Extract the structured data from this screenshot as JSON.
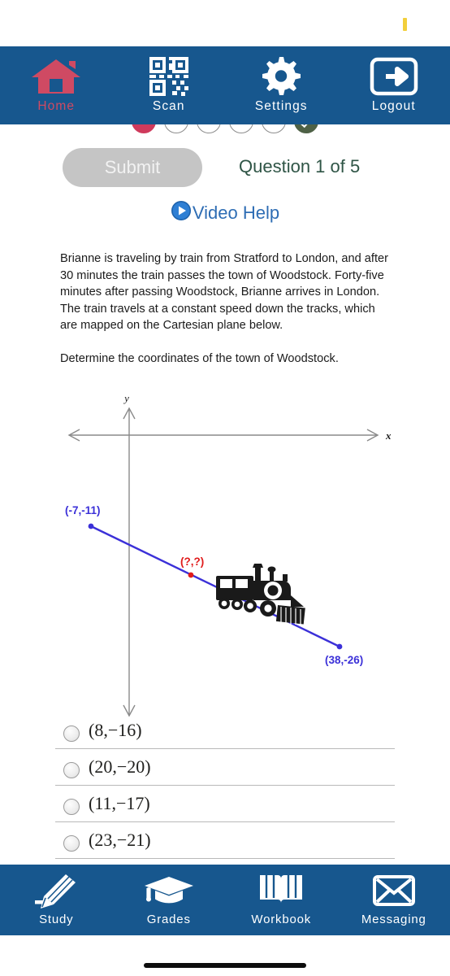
{
  "status_bar": {
    "indicator": "battery-mark"
  },
  "top_nav": {
    "items": [
      {
        "label": "Home",
        "icon": "home-icon"
      },
      {
        "label": "Scan",
        "icon": "qr-scan-icon"
      },
      {
        "label": "Settings",
        "icon": "gear-icon"
      },
      {
        "label": "Logout",
        "icon": "logout-arrow-icon"
      }
    ]
  },
  "progress": {
    "dots": [
      {
        "state": "current"
      },
      {
        "state": "empty"
      },
      {
        "state": "empty"
      },
      {
        "state": "empty"
      },
      {
        "state": "empty"
      },
      {
        "state": "done"
      }
    ]
  },
  "toolbar": {
    "submit_label": "Submit",
    "question_counter": "Question 1 of 5",
    "video_help_label": "Video Help"
  },
  "question": {
    "paragraph1": "Brianne is traveling by train from Stratford to London, and after 30 minutes the train passes the town of Woodstock. Forty-five minutes after passing Woodstock, Brianne arrives in London. The train travels at a constant speed down the tracks, which are mapped on the Cartesian plane below.",
    "paragraph2": "Determine the coordinates of the town of Woodstock."
  },
  "graph": {
    "x_axis_label": "x",
    "y_axis_label": "y",
    "point_start_label": "(-7,-11)",
    "point_unknown_label": "(?,?)",
    "point_end_label": "(38,-26)",
    "colors": {
      "axis": "#8a8a8a",
      "line": "#3b30d8",
      "unknown_point": "#e01b1b"
    }
  },
  "chart_data": {
    "type": "scatter",
    "title": "",
    "xlabel": "x",
    "ylabel": "y",
    "grid": false,
    "legend": null,
    "points": [
      {
        "label": "(-7,-11)",
        "x": -7,
        "y": -11,
        "color": "#3b30d8"
      },
      {
        "label": "(?,?)",
        "x": null,
        "y": null,
        "color": "#e01b1b"
      },
      {
        "label": "(38,-26)",
        "x": 38,
        "y": -26,
        "color": "#3b30d8"
      }
    ],
    "series": [
      {
        "name": "train track",
        "x": [
          -7,
          38
        ],
        "values": [
          -11,
          -26
        ],
        "color": "#3b30d8"
      }
    ],
    "annotations": [
      "train illustration on the track line"
    ]
  },
  "options": {
    "items": [
      {
        "label": "(8,−16)",
        "selected": false
      },
      {
        "label": "(20,−20)",
        "selected": false
      },
      {
        "label": "(11,−17)",
        "selected": false
      },
      {
        "label": "(23,−21)",
        "selected": false
      }
    ]
  },
  "bottom_nav": {
    "items": [
      {
        "label": "Study",
        "icon": "pencil-icon"
      },
      {
        "label": "Grades",
        "icon": "graduation-cap-icon"
      },
      {
        "label": "Workbook",
        "icon": "open-book-icon"
      },
      {
        "label": "Messaging",
        "icon": "envelope-icon"
      }
    ]
  }
}
